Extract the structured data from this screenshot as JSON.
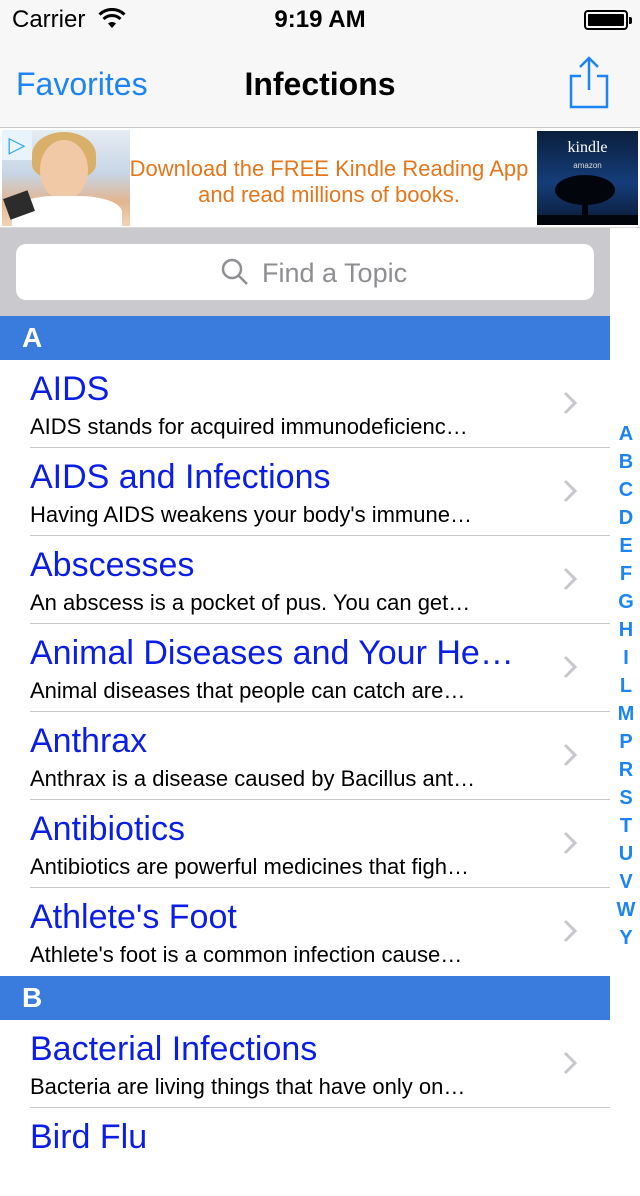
{
  "status_bar": {
    "carrier": "Carrier",
    "time": "9:19 AM"
  },
  "nav": {
    "back_label": "Favorites",
    "title": "Infections",
    "share_icon": "share-icon"
  },
  "ad": {
    "badge_icon": "adchoices-icon",
    "line1": "Download the FREE Kindle Reading App",
    "line2": "and read millions of books.",
    "brand": "kindle",
    "brand_sub": "amazon"
  },
  "search": {
    "placeholder": "Find a Topic",
    "icon": "search-icon"
  },
  "sections": [
    {
      "letter": "A",
      "rows": [
        {
          "title": "AIDS",
          "subtitle": "AIDS stands for acquired immunodeficienc…"
        },
        {
          "title": "AIDS and Infections",
          "subtitle": "Having AIDS weakens your body's immune…"
        },
        {
          "title": "Abscesses",
          "subtitle": "An abscess is a pocket of pus. You can get…"
        },
        {
          "title": "Animal Diseases and Your He…",
          "subtitle": "Animal diseases that people can catch are…"
        },
        {
          "title": "Anthrax",
          "subtitle": "Anthrax is a disease caused by Bacillus ant…"
        },
        {
          "title": "Antibiotics",
          "subtitle": "Antibiotics are powerful medicines that figh…"
        },
        {
          "title": "Athlete's Foot",
          "subtitle": "Athlete's foot is a common infection cause…"
        }
      ]
    },
    {
      "letter": "B",
      "rows": [
        {
          "title": "Bacterial Infections",
          "subtitle": "Bacteria are living things that have only on…"
        },
        {
          "title": "Bird Flu",
          "subtitle": ""
        }
      ]
    }
  ],
  "index_letters": [
    "A",
    "B",
    "C",
    "D",
    "E",
    "F",
    "G",
    "H",
    "I",
    "L",
    "M",
    "P",
    "R",
    "S",
    "T",
    "U",
    "V",
    "W",
    "Y"
  ],
  "colors": {
    "accent": "#1d84f5",
    "section_header": "#3a7bde",
    "row_title": "#0a1ee6",
    "ad_text": "#e6761c"
  }
}
